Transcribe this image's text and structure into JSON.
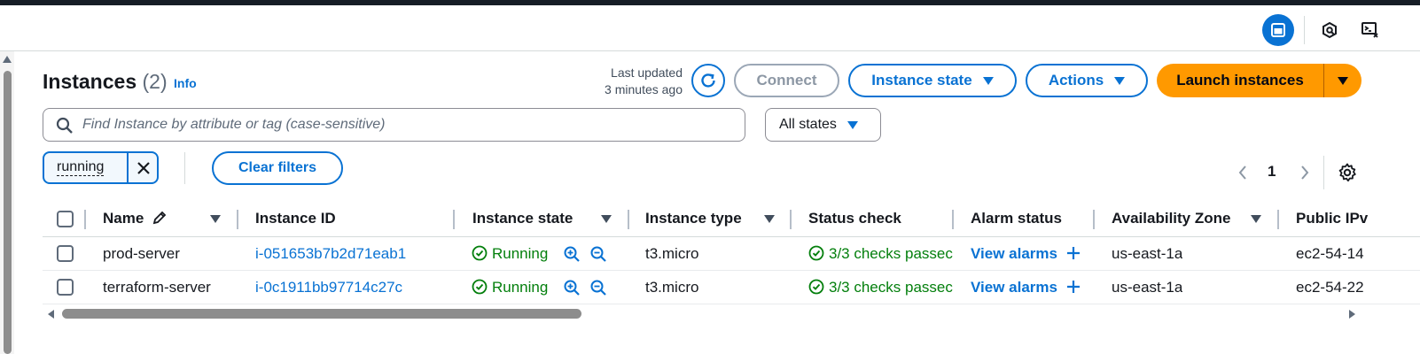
{
  "header": {
    "title": "Instances",
    "count": "(2)",
    "info_label": "Info",
    "last_updated_line1": "Last updated",
    "last_updated_line2": "3 minutes ago",
    "connect_label": "Connect",
    "instance_state_label": "Instance state",
    "actions_label": "Actions",
    "launch_label": "Launch instances"
  },
  "utilities": {
    "icons": [
      "panel-icon",
      "q-icon",
      "cloudshell-icon"
    ],
    "accent_color": "#0972d3"
  },
  "search": {
    "placeholder": "Find Instance by attribute or tag (case-sensitive)",
    "states_value": "All states"
  },
  "filters": {
    "token_label": "running",
    "clear_label": "Clear filters"
  },
  "pagination": {
    "current_page": "1"
  },
  "table": {
    "columns": [
      "Name",
      "Instance ID",
      "Instance state",
      "Instance type",
      "Status check",
      "Alarm status",
      "Availability Zone",
      "Public IPv"
    ],
    "rows": [
      {
        "name": "prod-server",
        "instance_id": "i-051653b7b2d71eab1",
        "state": "Running",
        "type": "t3.micro",
        "status_check": "3/3 checks passec",
        "alarm": "View alarms",
        "zone": "us-east-1a",
        "public_ip": "ec2-54-14"
      },
      {
        "name": "terraform-server",
        "instance_id": "i-0c1911bb97714c27c",
        "state": "Running",
        "type": "t3.micro",
        "status_check": "3/3 checks passec",
        "alarm": "View alarms",
        "zone": "us-east-1a",
        "public_ip": "ec2-54-22"
      }
    ]
  },
  "colors": {
    "primary": "#0972d3",
    "launch": "#ff9900",
    "success": "#037f0c",
    "topbar": "#161d26"
  }
}
